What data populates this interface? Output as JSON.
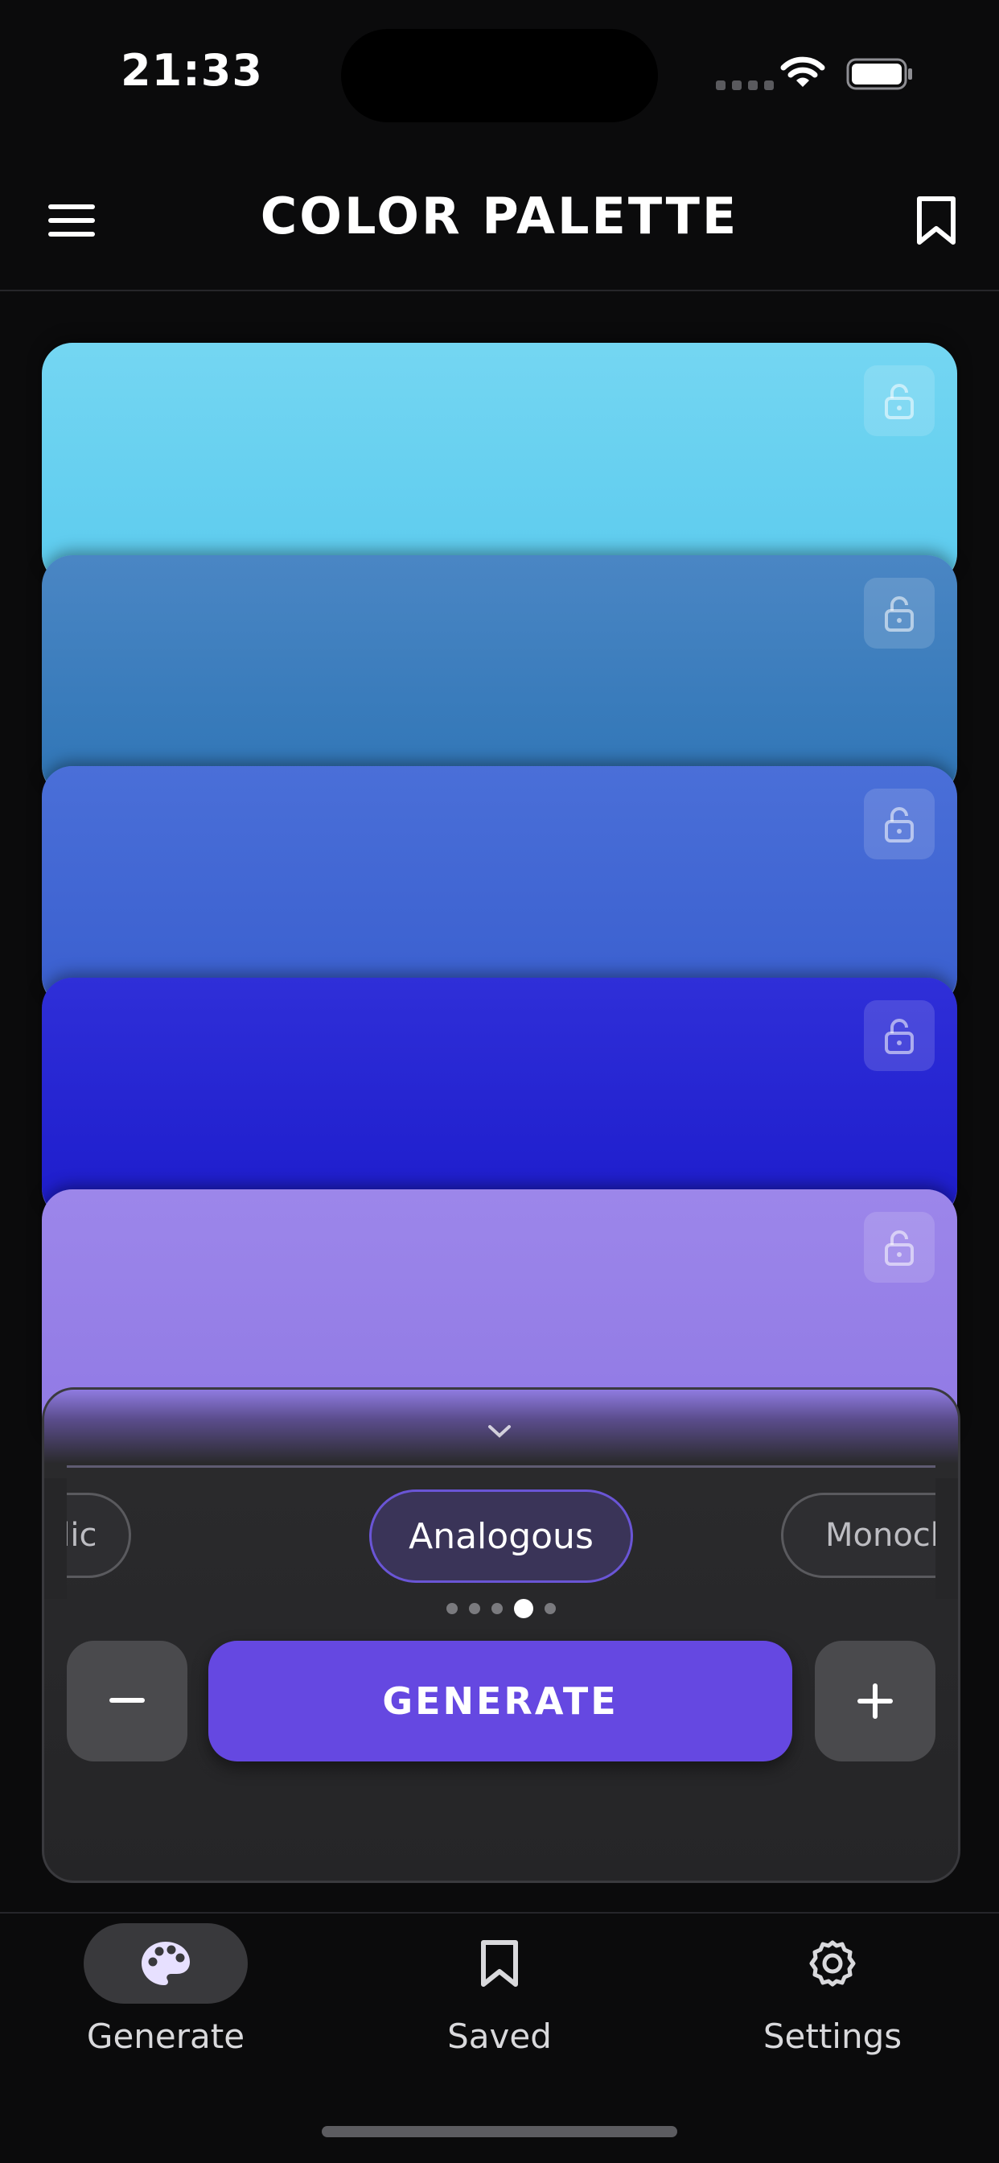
{
  "status_bar": {
    "time": "21:33"
  },
  "header": {
    "title": "COLOR PALETTE"
  },
  "palette": {
    "swatches": [
      {
        "gradient_top": "#74d6f2",
        "gradient_bottom": "#5ccbee",
        "locked": false
      },
      {
        "gradient_top": "#4a86c4",
        "gradient_bottom": "#2f75b6",
        "locked": false
      },
      {
        "gradient_top": "#4a6fd8",
        "gradient_bottom": "#3a5fcf",
        "locked": false
      },
      {
        "gradient_top": "#2f2fd8",
        "gradient_bottom": "#1d1ccc",
        "locked": false
      },
      {
        "gradient_top": "#9c86ea",
        "gradient_bottom": "#9079e4",
        "locked": false
      }
    ]
  },
  "controls": {
    "modes": {
      "left": "adic",
      "active": "Analogous",
      "right": "Monoch"
    },
    "page_dots": {
      "count": 5,
      "active_index": 3
    },
    "generate_label": "GENERATE",
    "accent": "#6548e1"
  },
  "tabs": [
    {
      "label": "Generate",
      "icon": "palette-icon",
      "selected": true
    },
    {
      "label": "Saved",
      "icon": "bookmark-icon",
      "selected": false
    },
    {
      "label": "Settings",
      "icon": "gear-icon",
      "selected": false
    }
  ]
}
